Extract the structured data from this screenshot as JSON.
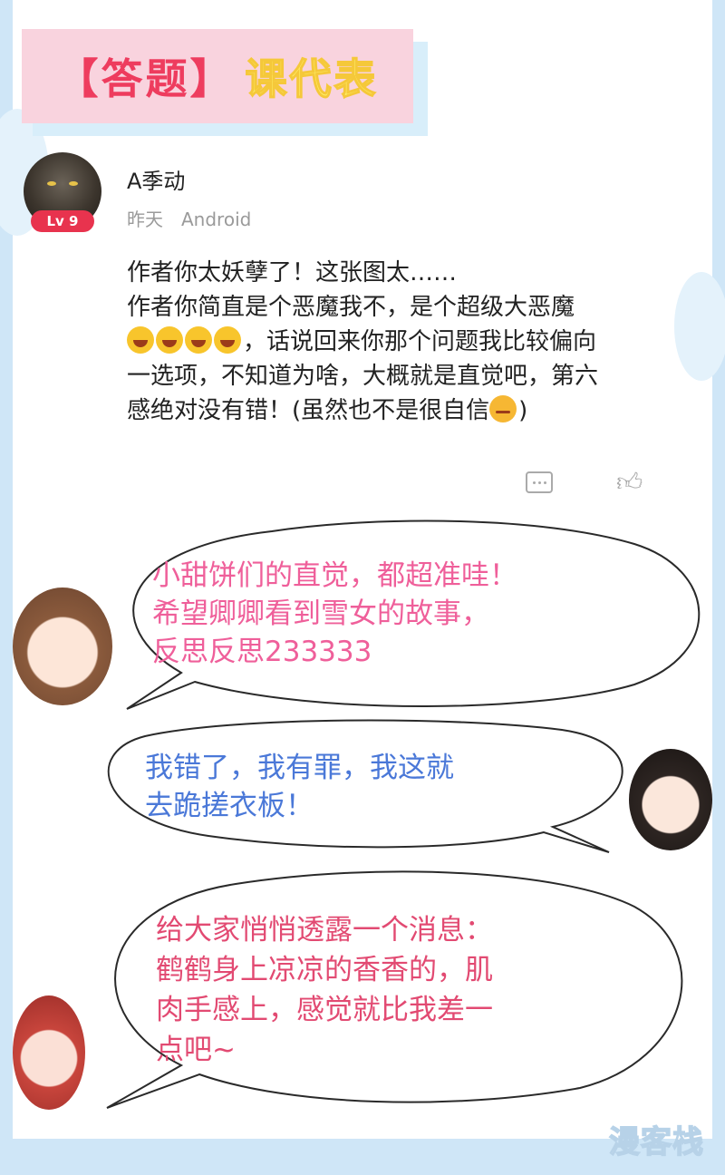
{
  "title": {
    "part1": "【答题】",
    "part2": "课代表"
  },
  "user": {
    "level_badge": "Lv 9",
    "name": "A季动",
    "time": "昨天",
    "platform": "Android"
  },
  "comment": {
    "line1": "作者你太妖孽了！这张图太……",
    "line2": "作者你简直是个恶魔我不，是个超级大恶魔",
    "line3": "，话说回来你那个问题我比较偏向",
    "line4": "一选项，不知道为啥，大概就是直觉吧，第六",
    "line5": "感绝对没有错！(虽然也不是很自信",
    "line5_end": ")"
  },
  "icons": {
    "reply": "comment-icon",
    "like": "thumbs-up-icon",
    "laugh": "laughing-emoji-icon",
    "sweat": "sweat-emoji-icon"
  },
  "bubbles": [
    {
      "lines": [
        "小甜饼们的直觉，都超准哇！",
        "希望卿卿看到雪女的故事，",
        "反思反思233333"
      ]
    },
    {
      "lines": [
        "我错了，我有罪，我这就",
        "去跪搓衣板！"
      ]
    },
    {
      "lines": [
        "给大家悄悄透露一个消息：",
        "鹤鹤身上凉凉的香香的，肌",
        "肉手感上，感觉就比我差一",
        "点吧~"
      ]
    }
  ],
  "watermark": "漫客栈",
  "colors": {
    "title_bg": "#f9d3de",
    "title_red": "#ee3c5e",
    "title_yellow": "#fff46c",
    "badge": "#e8334e",
    "bubble1_text": "#ef5f9a",
    "bubble2_text": "#4a78d8",
    "bubble3_text": "#e24a72",
    "page_bg": "#cfe6f7"
  }
}
